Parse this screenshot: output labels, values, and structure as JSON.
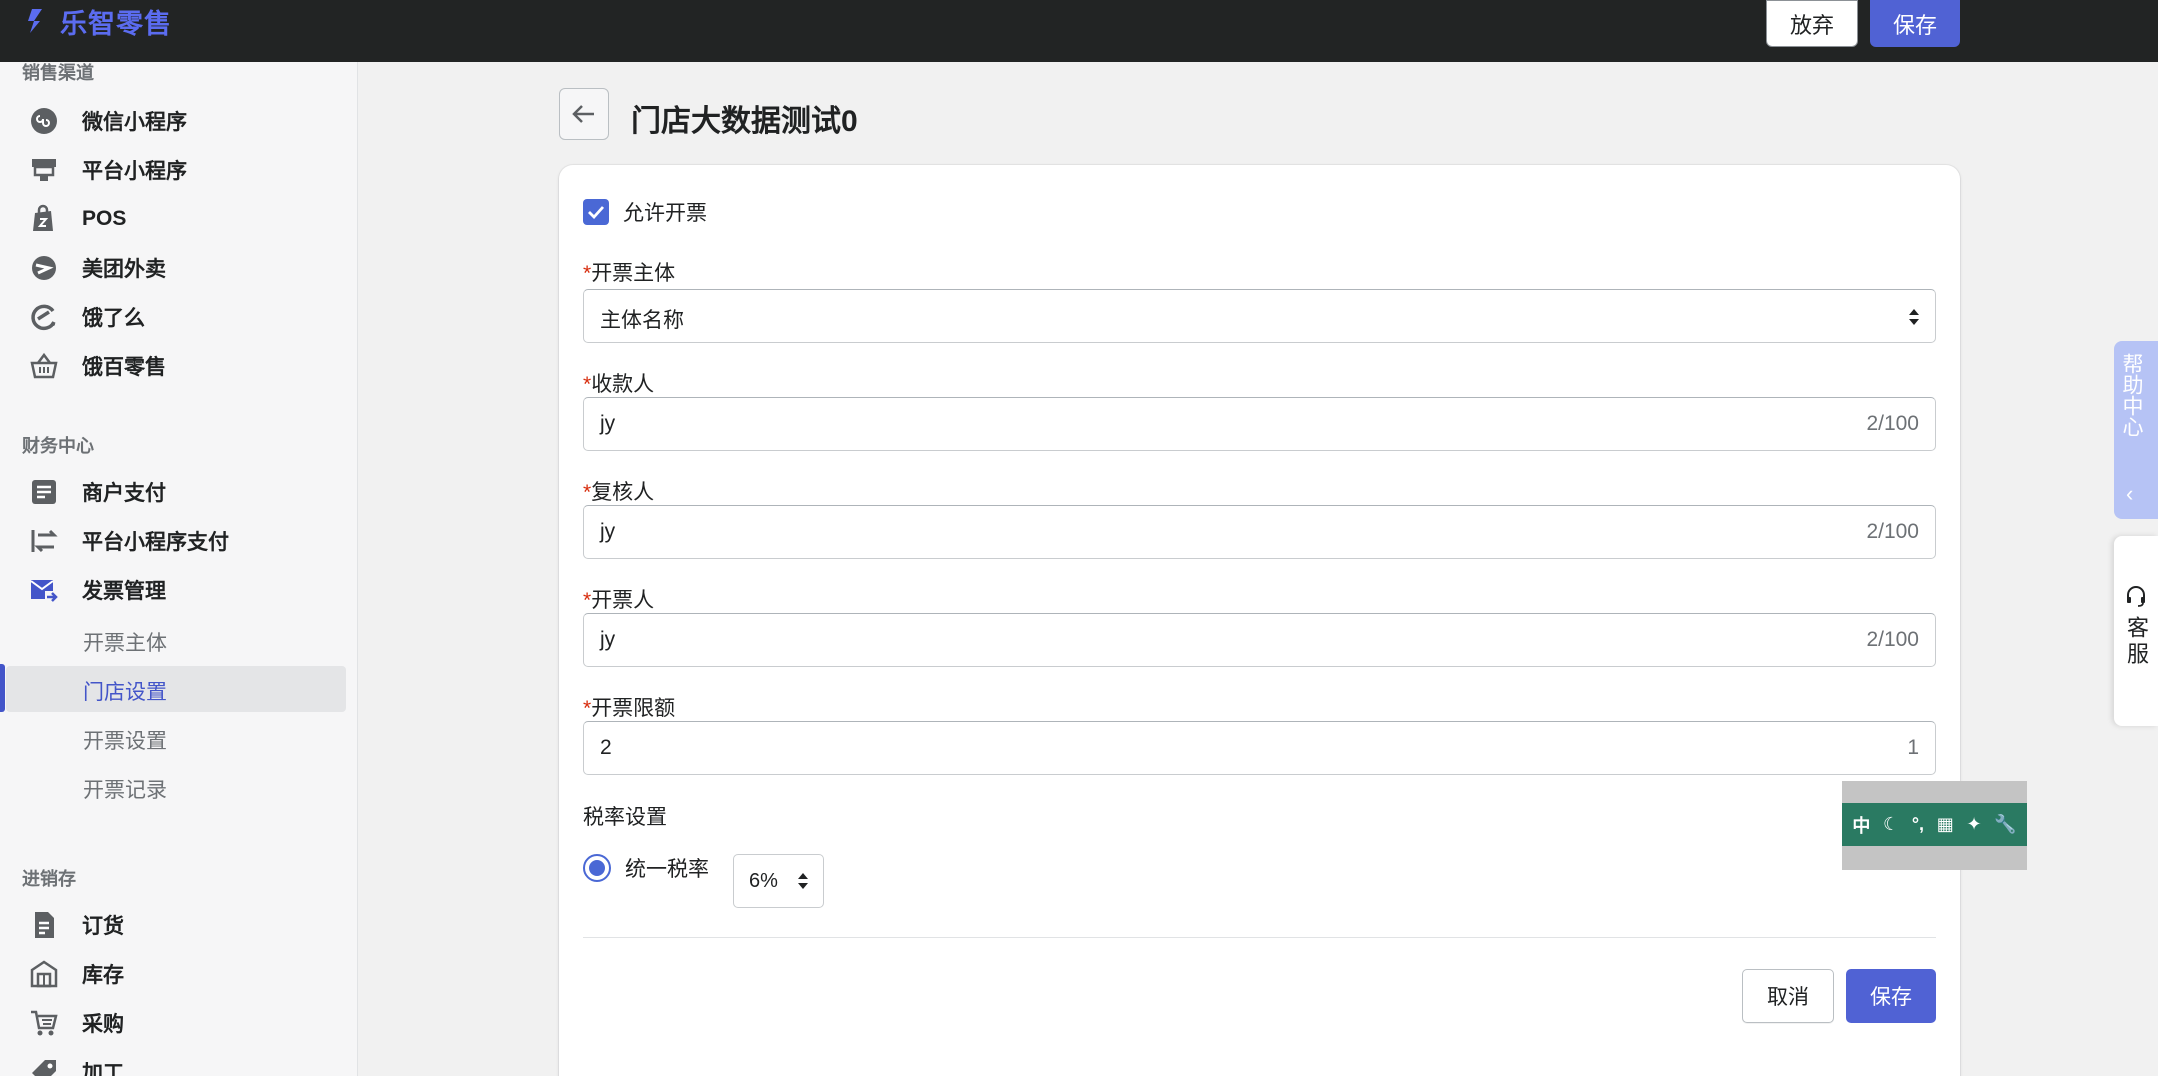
{
  "app": {
    "logo_text": "乐智零售",
    "discard_label": "放弃",
    "save_label": "保存"
  },
  "sidebar": {
    "sections": [
      {
        "title": "销售渠道",
        "items": [
          {
            "label": "微信小程序",
            "icon": "mini-program-icon"
          },
          {
            "label": "平台小程序",
            "icon": "storefront-icon"
          },
          {
            "label": "POS",
            "icon": "shopping-bag-icon"
          },
          {
            "label": "美团外卖",
            "icon": "meituan-icon"
          },
          {
            "label": "饿了么",
            "icon": "eleme-icon"
          },
          {
            "label": "饿百零售",
            "icon": "basket-icon"
          }
        ]
      },
      {
        "title": "财务中心",
        "items": [
          {
            "label": "商户支付",
            "icon": "receipt-icon"
          },
          {
            "label": "平台小程序支付",
            "icon": "transfer-icon"
          },
          {
            "label": "发票管理",
            "icon": "invoice-mail-icon"
          }
        ],
        "sub_items": [
          "开票主体",
          "门店设置",
          "开票设置",
          "开票记录"
        ],
        "active_sub": "门店设置"
      },
      {
        "title": "进销存",
        "items": [
          {
            "label": "订货",
            "icon": "order-document-icon"
          },
          {
            "label": "库存",
            "icon": "warehouse-icon"
          },
          {
            "label": "采购",
            "icon": "purchase-cart-icon"
          },
          {
            "label": "加工",
            "icon": "tag-icon"
          }
        ]
      }
    ]
  },
  "page": {
    "title": "门店大数据测试0"
  },
  "form": {
    "allow_invoice_label": "允许开票",
    "allow_invoice_checked": true,
    "subject": {
      "label": "开票主体",
      "value": "主体名称"
    },
    "payee": {
      "label": "收款人",
      "value": "jy",
      "count": "2/100"
    },
    "reviewer": {
      "label": "复核人",
      "value": "jy",
      "count": "2/100"
    },
    "drawer": {
      "label": "开票人",
      "value": "jy",
      "count": "2/100"
    },
    "limit": {
      "label": "开票限额",
      "value": "2",
      "count": "1"
    },
    "tax": {
      "title": "税率设置",
      "option_label": "统一税率",
      "rate_value": "6%"
    },
    "cancel_label": "取消",
    "save_label": "保存"
  },
  "ime": {
    "mode": "中",
    "punct": "°,"
  },
  "widgets": {
    "help_text": "帮助中心",
    "help_arrow": "‹",
    "service_text": "客服"
  },
  "colors": {
    "accent": "#5062d4",
    "topbar": "#222424",
    "required": "#d72c0d"
  }
}
